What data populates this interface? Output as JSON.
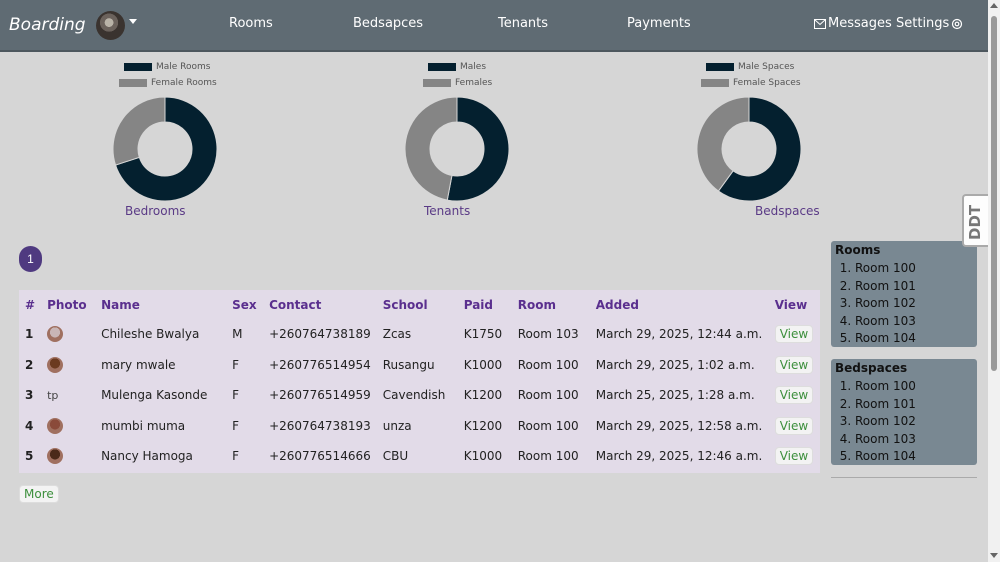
{
  "navbar": {
    "brand": "Boarding",
    "links": [
      "Rooms",
      "Bedsapces",
      "Tenants",
      "Payments"
    ],
    "messages": "Messages",
    "settings": "Settings",
    "background": "#5f6b73"
  },
  "charts": [
    {
      "label": "Bedrooms",
      "legend": [
        "Male Rooms",
        "Female Rooms"
      ],
      "values": [
        70,
        30
      ],
      "colors": [
        "#04202f",
        "#858585"
      ]
    },
    {
      "label": "Tenants",
      "legend": [
        "Males",
        "Females"
      ],
      "values": [
        53,
        47
      ],
      "colors": [
        "#04202f",
        "#858585"
      ]
    },
    {
      "label": "Bedspaces",
      "legend": [
        "Male Spaces",
        "Female Spaces"
      ],
      "values": [
        60,
        40
      ],
      "colors": [
        "#04202f",
        "#858585"
      ]
    }
  ],
  "pagination": {
    "current": "1"
  },
  "table": {
    "headers": [
      "#",
      "Photo",
      "Name",
      "Sex",
      "Contact",
      "School",
      "Paid",
      "Room",
      "Added",
      "View"
    ],
    "rows": [
      {
        "num": "1",
        "photo": "avatar",
        "name": "Chileshe Bwalya",
        "sex": "M",
        "contact": "+260764738189",
        "school": "Zcas",
        "paid": "K1750",
        "room": "Room 103",
        "added": "March 29, 2025, 12:44 a.m.",
        "view": "View"
      },
      {
        "num": "2",
        "photo": "avatar",
        "name": "mary mwale",
        "sex": "F",
        "contact": "+260776514954",
        "school": "Rusangu",
        "paid": "K1000",
        "room": "Room 100",
        "added": "March 29, 2025, 1:02 a.m.",
        "view": "View"
      },
      {
        "num": "3",
        "photo": "tp",
        "name": "Mulenga Kasonde",
        "sex": "F",
        "contact": "+260776514959",
        "school": "Cavendish",
        "paid": "K1200",
        "room": "Room 100",
        "added": "March 25, 2025, 1:28 a.m.",
        "view": "View"
      },
      {
        "num": "4",
        "photo": "avatar",
        "name": "mumbi muma",
        "sex": "F",
        "contact": "+260764738193",
        "school": "unza",
        "paid": "K1200",
        "room": "Room 100",
        "added": "March 29, 2025, 12:58 a.m.",
        "view": "View"
      },
      {
        "num": "5",
        "photo": "avatar",
        "name": "Nancy Hamoga",
        "sex": "F",
        "contact": "+260776514666",
        "school": "CBU",
        "paid": "K1000",
        "room": "Room 100",
        "added": "March 29, 2025, 12:46 a.m.",
        "view": "View"
      }
    ],
    "photo_colors": [
      "#c9b6b6",
      "#6b3a20",
      "#ffffff",
      "#8a4a3a",
      "#4a2a1a"
    ]
  },
  "more_label": "More",
  "sidebar": {
    "rooms": {
      "title": "Rooms",
      "items": [
        "Room 100",
        "Room 101",
        "Room 102",
        "Room 103",
        "Room 104"
      ]
    },
    "bedspaces": {
      "title": "Bedspaces",
      "items": [
        "Room 100",
        "Room 101",
        "Room 102",
        "Room 103",
        "Room 104"
      ]
    }
  },
  "side_tab": "DDT"
}
